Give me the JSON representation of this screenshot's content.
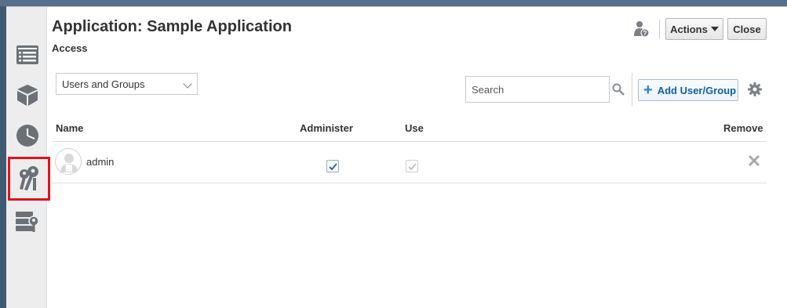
{
  "dialog": {
    "title": "Application: Sample Application",
    "section": "Access"
  },
  "header": {
    "help_icon": "user-help-icon",
    "actions_label": "Actions",
    "close_label": "Close"
  },
  "rail": {
    "items": [
      {
        "icon": "list-icon",
        "active": false
      },
      {
        "icon": "cube-icon",
        "active": false
      },
      {
        "icon": "clock-icon",
        "active": false
      },
      {
        "icon": "keys-icon",
        "active": true
      },
      {
        "icon": "database-key-icon",
        "active": false
      }
    ]
  },
  "toolbar": {
    "filter_selected": "Users and Groups",
    "search_placeholder": "Search",
    "add_label": "Add User/Group"
  },
  "table": {
    "columns": {
      "name": "Name",
      "administer": "Administer",
      "use": "Use",
      "remove": "Remove"
    },
    "rows": [
      {
        "name": "admin",
        "administer": true,
        "use": true,
        "use_disabled": true
      }
    ]
  },
  "colors": {
    "accent": "#0d5fa6",
    "active_highlight": "#e0141a",
    "rail_background": "#ededed"
  }
}
